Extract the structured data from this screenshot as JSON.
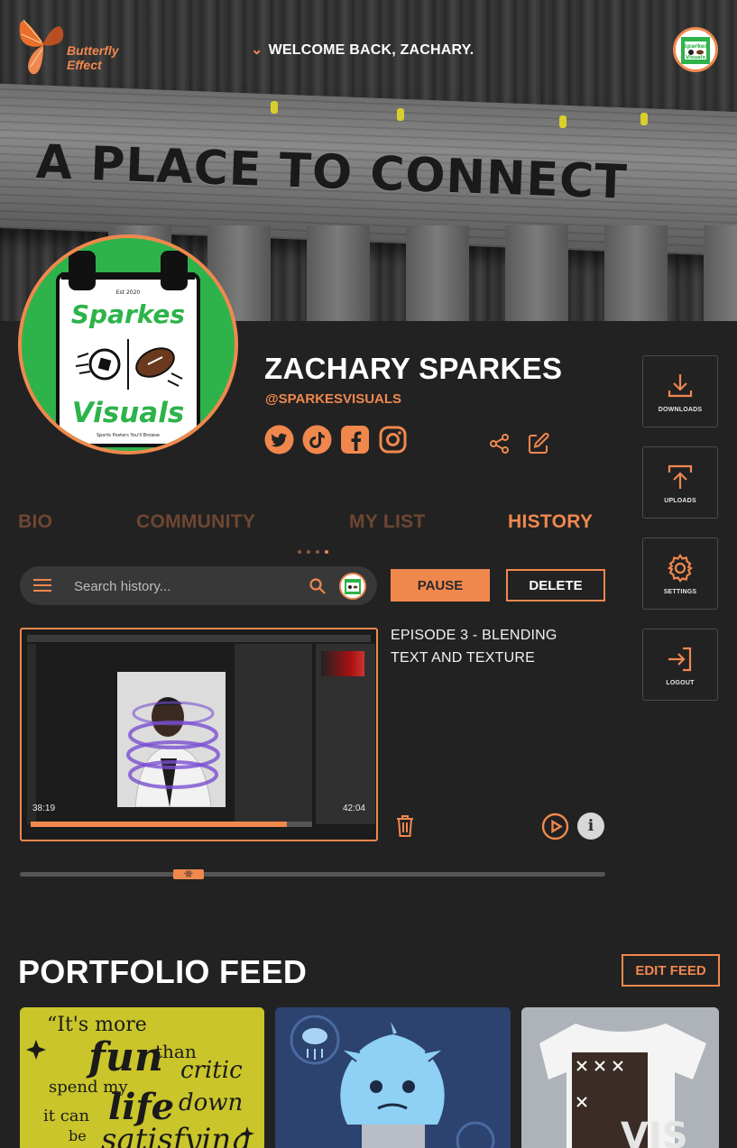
{
  "header": {
    "brand_line1": "Butterfly",
    "brand_line2": "Effect",
    "welcome": "WELCOME BACK, ZACHARY.",
    "banner_text": "A PLACE TO CONNECT"
  },
  "avatar": {
    "est": "Est 2020",
    "line1": "Sparkes",
    "line2": "Visuals",
    "tagline": "Sports Posters You'll Browse"
  },
  "profile": {
    "name": "ZACHARY SPARKES",
    "handle": "@SPARKESVISUALS",
    "socials": [
      "twitter-icon",
      "tiktok-icon",
      "facebook-icon",
      "instagram-icon"
    ]
  },
  "sidebar": {
    "downloads": "DOWNLOADS",
    "uploads": "UPLOADS",
    "settings": "SETTINGS",
    "logout": "LOGOUT"
  },
  "tabs": [
    {
      "label": "BIO",
      "active": false
    },
    {
      "label": "COMMUNITY",
      "active": false
    },
    {
      "label": "MY LIST",
      "active": false
    },
    {
      "label": "HISTORY",
      "active": true
    }
  ],
  "history": {
    "search_placeholder": "Search history...",
    "pause_label": "PAUSE",
    "delete_label": "DELETE",
    "current_time": "38:19",
    "duration": "42:04",
    "progress": 0.91,
    "episode_title": "EPISODE 3 - BLENDING TEXT AND TEXTURE",
    "scroll_label": "·|||·"
  },
  "portfolio": {
    "title": "PORTFOLIO FEED",
    "edit_label": "EDIT FEED"
  },
  "colors": {
    "accent": "#f0884e",
    "background": "#222222",
    "avatar_green": "#2db34a"
  }
}
